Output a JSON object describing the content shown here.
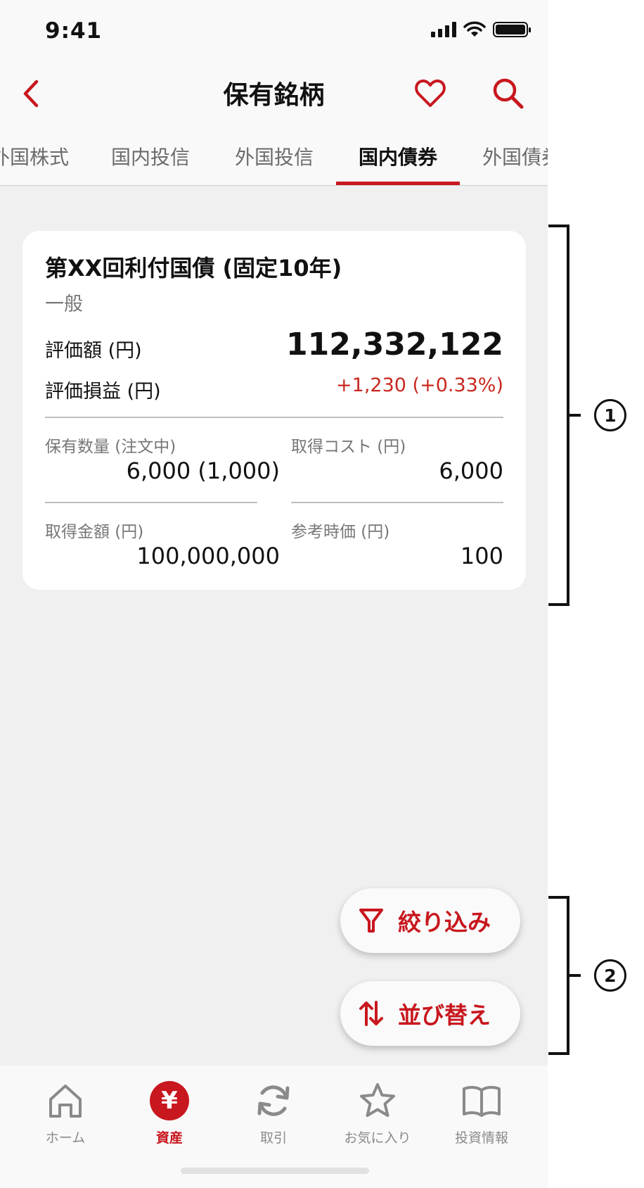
{
  "status_bar": {
    "time": "9:41"
  },
  "nav": {
    "title": "保有銘柄"
  },
  "tabs": [
    {
      "label": "外国株式",
      "active": false
    },
    {
      "label": "国内投信",
      "active": false
    },
    {
      "label": "外国投信",
      "active": false
    },
    {
      "label": "国内債券",
      "active": true
    },
    {
      "label": "外国債券",
      "active": false
    }
  ],
  "holding": {
    "name": "第XX回利付国債 (固定10年)",
    "account_type": "一般",
    "valuation_label": "評価額 (円)",
    "valuation": "112,332,122",
    "pl_label": "評価損益 (円)",
    "pl": "+1,230 (+0.33%)",
    "quantity_label": "保有数量 (注文中)",
    "quantity": "6,000 (1,000)",
    "cost_label": "取得コスト (円)",
    "cost": "6,000",
    "amount_label": "取得金額 (円)",
    "amount": "100,000,000",
    "ref_price_label": "参考時価 (円)",
    "ref_price": "100"
  },
  "actions": {
    "filter_label": "絞り込み",
    "sort_label": "並び替え"
  },
  "tabbar": [
    {
      "label": "ホーム",
      "icon": "home-icon",
      "active": false
    },
    {
      "label": "資産",
      "icon": "yen-icon",
      "active": true,
      "glyph": "¥"
    },
    {
      "label": "取引",
      "icon": "refresh-icon",
      "active": false
    },
    {
      "label": "お気に入り",
      "icon": "star-icon",
      "active": false
    },
    {
      "label": "投資情報",
      "icon": "book-icon",
      "active": false
    }
  ],
  "annotations": {
    "marker_1": "1",
    "marker_2": "2"
  },
  "colors": {
    "accent": "#c8171e",
    "loss_gain": "#c8281e",
    "background": "#f0f0f0"
  }
}
